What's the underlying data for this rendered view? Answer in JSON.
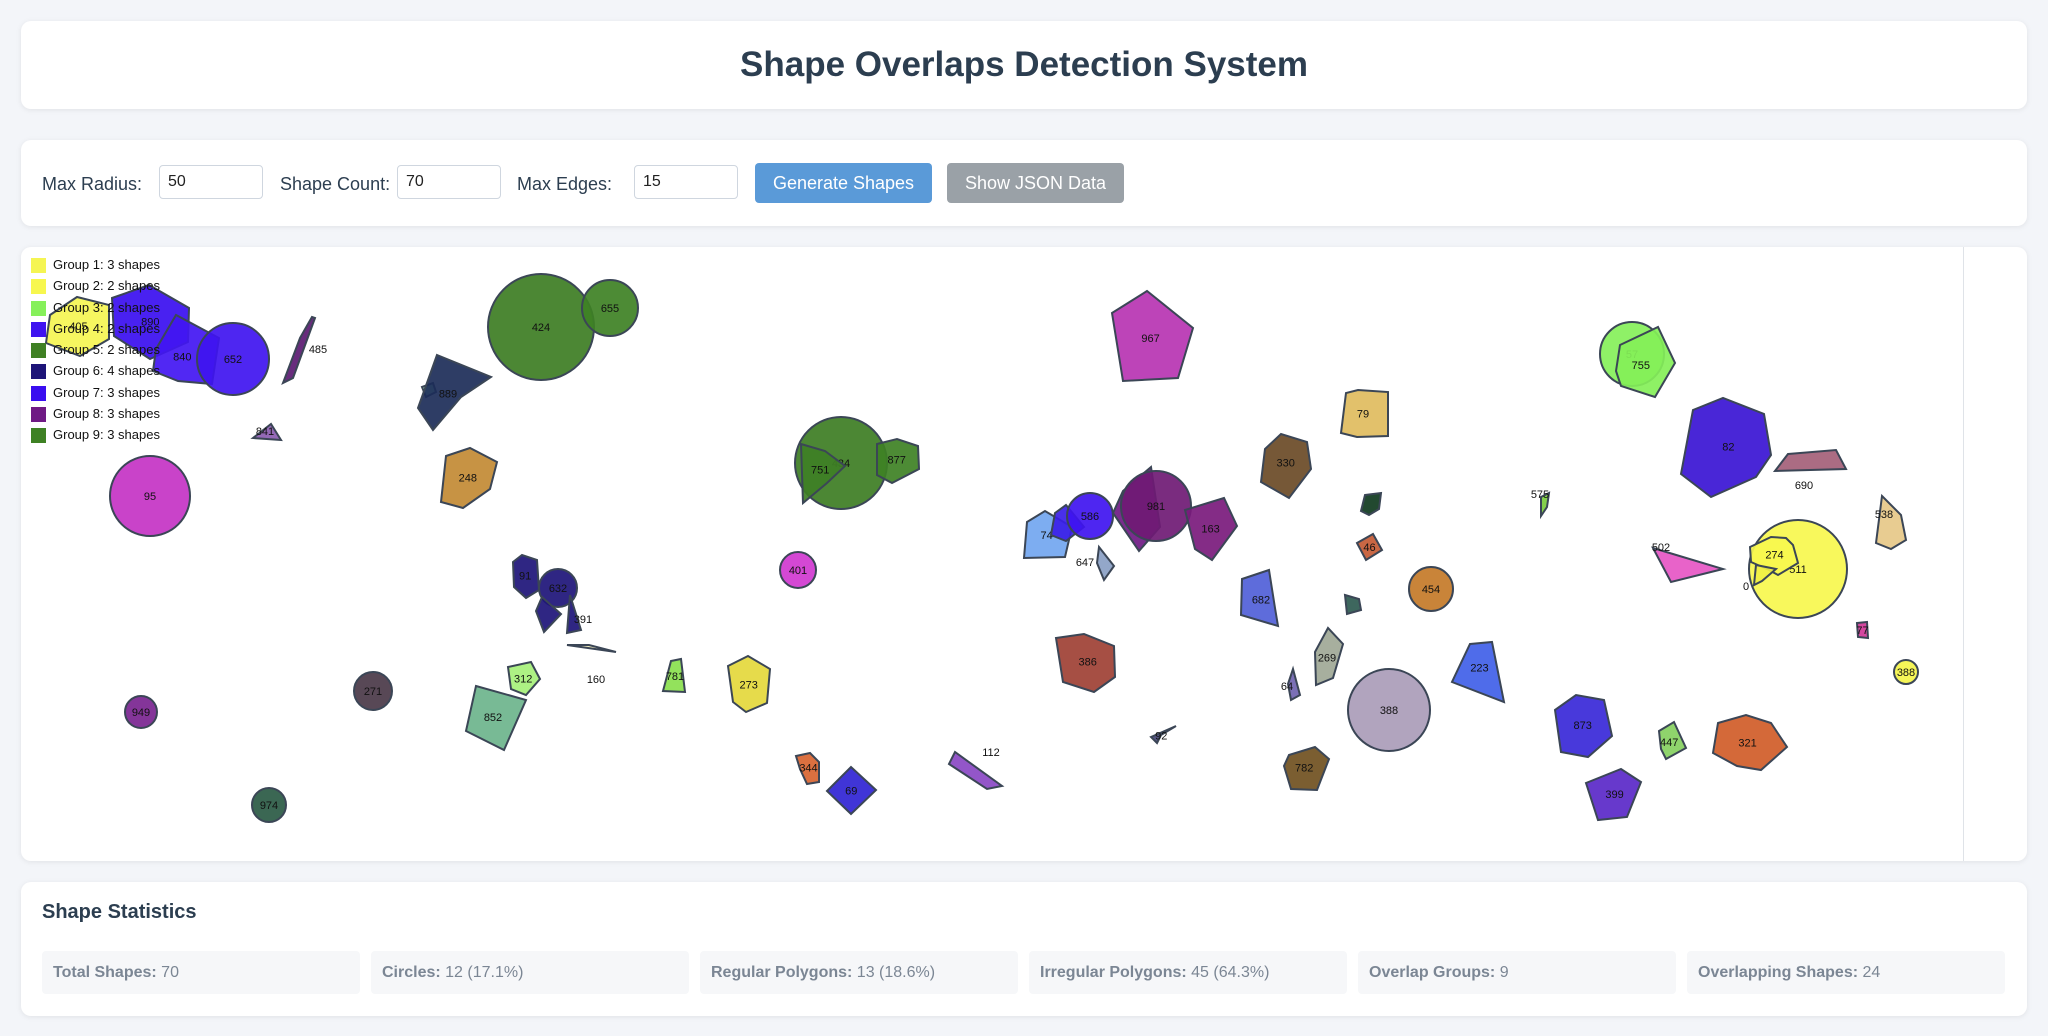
{
  "title": "Shape Overlaps Detection System",
  "controls": {
    "max_radius_label": "Max Radius:",
    "max_radius_value": "50",
    "shape_count_label": "Shape Count:",
    "shape_count_value": "70",
    "max_edges_label": "Max Edges:",
    "max_edges_value": "15",
    "generate_button": "Generate Shapes",
    "json_button": "Show JSON Data",
    "generate_color": "#5a9ad8",
    "json_color": "#9aa1a7"
  },
  "legend": [
    {
      "label": "Group 1: 3 shapes",
      "color": "#f5f553"
    },
    {
      "label": "Group 2: 2 shapes",
      "color": "#f7f74e"
    },
    {
      "label": "Group 3: 2 shapes",
      "color": "#86f05a"
    },
    {
      "label": "Group 4: 2 shapes",
      "color": "#3f14f0"
    },
    {
      "label": "Group 5: 2 shapes",
      "color": "#3f8023"
    },
    {
      "label": "Group 6: 4 shapes",
      "color": "#1d1478"
    },
    {
      "label": "Group 7: 3 shapes",
      "color": "#3a0ef0"
    },
    {
      "label": "Group 8: 3 shapes",
      "color": "#6f1a84"
    },
    {
      "label": "Group 9: 3 shapes",
      "color": "#3e8124"
    }
  ],
  "shapes": [
    {
      "type": "circle",
      "label": "424",
      "color": "#3d7d23"
    },
    {
      "type": "circle",
      "label": "655",
      "color": "#3e8124"
    },
    {
      "type": "polygon",
      "label": "967",
      "color": "#b734b2"
    },
    {
      "type": "polygon",
      "label": "405",
      "color": "#f5f553"
    },
    {
      "type": "polygon",
      "label": "890",
      "color": "#3a0ef0"
    },
    {
      "type": "polygon",
      "label": "840",
      "color": "#4216f2"
    },
    {
      "type": "circle",
      "label": "652",
      "color": "#3f14f0"
    },
    {
      "type": "polygon",
      "label": "485",
      "color": "#5b1a72"
    },
    {
      "type": "polygon",
      "label": "",
      "color": "#9fe8b8"
    },
    {
      "type": "polygon",
      "label": "889",
      "color": "#1c2d58"
    },
    {
      "type": "polygon",
      "label": "248",
      "color": "#c28a34"
    },
    {
      "type": "polygon",
      "label": "841",
      "color": "#8a5cb0"
    },
    {
      "type": "circle",
      "label": "95",
      "color": "#c433c4"
    },
    {
      "type": "circle",
      "label": "434",
      "color": "#3d7d23"
    },
    {
      "type": "polygon",
      "label": "751",
      "color": "#3e7f25"
    },
    {
      "type": "polygon",
      "label": "877",
      "color": "#3e8124"
    },
    {
      "type": "polygon",
      "label": "79",
      "color": "#e0bc5e"
    },
    {
      "type": "polygon",
      "label": "330",
      "color": "#6a4a26"
    },
    {
      "type": "polygon",
      "label": "57",
      "color": "#86f05a"
    },
    {
      "type": "polygon",
      "label": "755",
      "color": "#84f058"
    },
    {
      "type": "polygon",
      "label": "82",
      "color": "#3a14d4"
    },
    {
      "type": "polygon",
      "label": "690",
      "color": "#a46078"
    },
    {
      "type": "polygon",
      "label": "74",
      "color": "#72a6f0"
    },
    {
      "type": "polygon",
      "label": "",
      "color": "#3a1ee8"
    },
    {
      "type": "circle",
      "label": "586",
      "color": "#3f14f0"
    },
    {
      "type": "polygon",
      "label": "",
      "color": "#6f1a84"
    },
    {
      "type": "circle",
      "label": "981",
      "color": "#6f1a74"
    },
    {
      "type": "polygon",
      "label": "163",
      "color": "#7a1a7c"
    },
    {
      "type": "polygon",
      "label": "",
      "color": "#0f3a1e"
    },
    {
      "type": "polygon",
      "label": "575",
      "color": "#7acc3c"
    },
    {
      "type": "polygon",
      "label": "538",
      "color": "#e6c888"
    },
    {
      "type": "polygon",
      "label": "502",
      "color": "#e656c4"
    },
    {
      "type": "circle",
      "label": "511",
      "color": "#f7f74e"
    },
    {
      "type": "polygon",
      "label": "274",
      "color": "#f7f74e"
    },
    {
      "type": "polygon",
      "label": "0",
      "color": "#f0f044"
    },
    {
      "type": "polygon",
      "label": "647",
      "color": "#8aa0c4"
    },
    {
      "type": "polygon",
      "label": "46",
      "color": "#c45a34"
    },
    {
      "type": "circle",
      "label": "454",
      "color": "#c47a28"
    },
    {
      "type": "polygon",
      "label": "682",
      "color": "#5060d8"
    },
    {
      "type": "polygon",
      "label": "",
      "color": "#2e5a50"
    },
    {
      "type": "circle",
      "label": "401",
      "color": "#d038d0"
    },
    {
      "type": "polygon",
      "label": "91",
      "color": "#1d1478"
    },
    {
      "type": "circle",
      "label": "632",
      "color": "#1d1478"
    },
    {
      "type": "polygon",
      "label": "",
      "color": "#1d1478"
    },
    {
      "type": "polygon",
      "label": "391",
      "color": "#1d1478"
    },
    {
      "type": "polygon",
      "label": "160",
      "color": "#f0eab8"
    },
    {
      "type": "polygon",
      "label": "312",
      "color": "#a6f07a"
    },
    {
      "type": "polygon",
      "label": "852",
      "color": "#6cb48c"
    },
    {
      "type": "circle",
      "label": "271",
      "color": "#4a3848"
    },
    {
      "type": "circle",
      "label": "949",
      "color": "#7a2490"
    },
    {
      "type": "circle",
      "label": "974",
      "color": "#2a5a44"
    },
    {
      "type": "polygon",
      "label": "781",
      "color": "#8ae04e"
    },
    {
      "type": "polygon",
      "label": "273",
      "color": "#e4d83c"
    },
    {
      "type": "polygon",
      "label": "344",
      "color": "#d86430"
    },
    {
      "type": "polygon",
      "label": "69",
      "color": "#3024d4"
    },
    {
      "type": "polygon",
      "label": "112",
      "color": "#8a48c4"
    },
    {
      "type": "polygon",
      "label": "386",
      "color": "#9e4034"
    },
    {
      "type": "polygon",
      "label": "92",
      "color": "#484878"
    },
    {
      "type": "polygon",
      "label": "64",
      "color": "#7064b0"
    },
    {
      "type": "polygon",
      "label": "269",
      "color": "#a0a896"
    },
    {
      "type": "circle",
      "label": "388",
      "color": "#aa9cb8"
    },
    {
      "type": "polygon",
      "label": "782",
      "color": "#705020"
    },
    {
      "type": "polygon",
      "label": "223",
      "color": "#4060e8"
    },
    {
      "type": "polygon",
      "label": "873",
      "color": "#3828d8"
    },
    {
      "type": "polygon",
      "label": "399",
      "color": "#5a28c8"
    },
    {
      "type": "polygon",
      "label": "447",
      "color": "#86d060"
    },
    {
      "type": "polygon",
      "label": "321",
      "color": "#d05c28"
    },
    {
      "type": "polygon",
      "label": "77",
      "color": "#d03898"
    },
    {
      "type": "circle",
      "label": "388",
      "color": "#f4f44a"
    }
  ],
  "stats": {
    "heading": "Shape Statistics",
    "items": [
      {
        "label": "Total Shapes:",
        "value": "70"
      },
      {
        "label": "Circles:",
        "value": "12 (17.1%)"
      },
      {
        "label": "Regular Polygons:",
        "value": "13 (18.6%)"
      },
      {
        "label": "Irregular Polygons:",
        "value": "45 (64.3%)"
      },
      {
        "label": "Overlap Groups:",
        "value": "9"
      },
      {
        "label": "Overlapping Shapes:",
        "value": "24"
      }
    ]
  }
}
